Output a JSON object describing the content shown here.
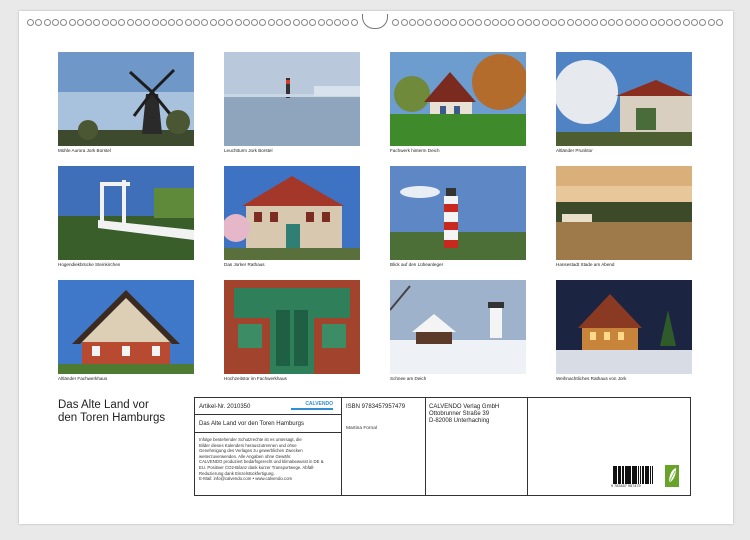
{
  "calendar": {
    "title_line1": "Das Alte Land vor",
    "title_line2": "den Toren Hamburgs"
  },
  "photos": [
    {
      "caption": "Mühle Aurora Jork Borstel"
    },
    {
      "caption": "Leuchtturm Jork Borstel"
    },
    {
      "caption": "Fachwerk hinterm Deich"
    },
    {
      "caption": "Altländer Prunktor"
    },
    {
      "caption": "Hogendiekbrücke Steinkirchen"
    },
    {
      "caption": "Das Jorker Rathaus"
    },
    {
      "caption": "Blick auf den Lüheanleger"
    },
    {
      "caption": "Hansestadt Stade am Abend"
    },
    {
      "caption": "Altländer Fachwerkhaus"
    },
    {
      "caption": "Hochzeitstür im Fachwerkhaus"
    },
    {
      "caption": "Schnee am Deich"
    },
    {
      "caption": "Weihnachtliches Rathaus von Jork"
    }
  ],
  "info": {
    "article": "Artikel-Nr. 2010350",
    "logo_brand": "CALVENDO",
    "logo_sub": "...",
    "product_title": "Das Alte Land vor den Toren Hamburgs",
    "disclaimer": [
      "Infolge bestehender Schutzrechte ist es untersagt, die",
      "Bilder dieses Kalenders herauszutrennen und ohne",
      "Genehmigung des Verlages zu gewerblichen Zwecken",
      "weiterzuverwenden. Alle Angaben ohne Gewähr.",
      "CALVENDO produziert bedarfsgerecht und klimabewusst in DE &",
      "EU. Positiver CO2-Bilanz dank kurzer Transportwege. Abfall-",
      "Reduzierung dank Einzelstückfertigung.",
      "E-Mail: info@calvendo.com • www.calvendo.com"
    ],
    "isbn": "ISBN 9783457957479",
    "author": "Martina Fornal",
    "publisher_lines": [
      "CALVENDO Verlag GmbH",
      "Ottobrunner Straße 39",
      "D-82008 Unterhaching"
    ],
    "barcode_number": "9 783457 957479"
  },
  "colors": {
    "sheet": "#ffffff",
    "frame": "#333333",
    "logo_green": "#6aa329"
  }
}
